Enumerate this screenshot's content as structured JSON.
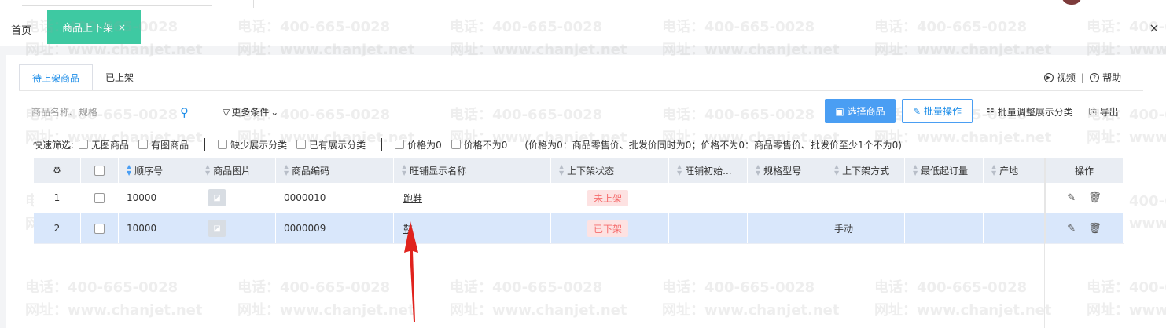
{
  "tabs": {
    "home": "首页",
    "active": "商品上下架",
    "active_close": "×",
    "close_all": "×"
  },
  "subtabs": [
    "待上架商品",
    "已上架"
  ],
  "help": {
    "video": "视频",
    "separator": "|",
    "help": "帮助"
  },
  "search": {
    "placeholder": "商品名称、规格",
    "more": "更多条件"
  },
  "toolbar": {
    "select": "选择商品",
    "batch": "批量操作",
    "adjust": "批量调整展示分类",
    "export": "导出"
  },
  "quick_filter": {
    "label": "快速筛选:",
    "items": [
      "无图商品",
      "有图商品",
      "缺少展示分类",
      "已有展示分类",
      "价格为0",
      "价格不为0"
    ],
    "note": "(价格为0：商品零售价、批发价同时为0；价格不为0：商品零售价、批发价至少1个不为0)"
  },
  "table": {
    "headers": {
      "seq": "顺序号",
      "img": "商品图片",
      "code": "商品编码",
      "name": "旺铺显示名称",
      "status": "上下架状态",
      "init": "旺铺初始...",
      "spec": "规格型号",
      "mode": "上下架方式",
      "min": "最低起订量",
      "origin": "产地",
      "ops": "操作"
    },
    "rows": [
      {
        "index": "1",
        "seq": "10000",
        "code": "0000010",
        "name": "跑鞋",
        "status": "未上架",
        "mode": ""
      },
      {
        "index": "2",
        "seq": "10000",
        "code": "0000009",
        "name": "鞋",
        "status": "已下架",
        "mode": "手动"
      }
    ]
  },
  "watermark": {
    "phone": "电话：400-665-0028",
    "site": "网址：www.chanjet.net"
  },
  "colors": {
    "accent": "#3ec9a2",
    "primary": "#4a9ef3",
    "danger": "#f56c6c",
    "selected_row": "#d9e7fb",
    "arrow": "#e0221d"
  }
}
